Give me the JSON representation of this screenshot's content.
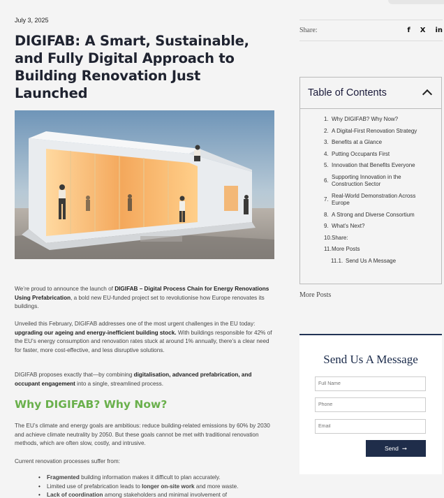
{
  "article": {
    "date": "July 3, 2025",
    "title": "DIGIFAB: A Smart, Sustainable, and Fully Digital Approach to Building Renovation Just Launched",
    "p1_a": "We’re proud to announce the launch of ",
    "p1_b": "DIGIFAB – Digital Process Chain for Energy Renovations Using Prefabrication",
    "p1_c": ", a bold new EU-funded project set to revolutionise how Europe renovates its buildings.",
    "p2_a": "Unveiled this February, DIGIFAB addresses one of the most urgent challenges in the EU today: ",
    "p2_b": "upgrading our ageing and energy-inefficient building stock.",
    "p2_c": " With buildings responsible for 42% of the EU’s energy consumption and renovation rates stuck at around 1% annually, there’s a clear need for faster, more cost-effective, and less disruptive solutions.",
    "p3_a": "DIGIFAB proposes exactly that—by combining ",
    "p3_b": "digitalisation, advanced prefabrication, and occupant engagement",
    "p3_c": " into a single, streamlined process.",
    "h2": "Why DIGIFAB? Why Now?",
    "p4": "The EU’s climate and energy goals are ambitious: reduce building-related emissions by 60% by 2030 and achieve climate neutrality by 2050. But these goals cannot be met with traditional renovation methods, which are often slow, costly, and intrusive.",
    "p5": "Current renovation processes suffer from:",
    "bullets": [
      {
        "bold": "Fragmented",
        "text": " building information makes it difficult to plan accurately."
      },
      {
        "pre": "Limited use of prefabrication leads to ",
        "bold": "longer on-site work",
        "text": " and more waste."
      },
      {
        "bold": "Lack of coordination",
        "text": " among stakeholders and minimal involvement of"
      }
    ]
  },
  "sidebar": {
    "share_label": "Share:",
    "share_icons": [
      "f",
      "X",
      "in"
    ],
    "toc_title": "Table of Contents",
    "toc": [
      {
        "num": "1.",
        "text": "Why DIGIFAB? Why Now?"
      },
      {
        "num": "2.",
        "text": "A Digital-First Renovation Strategy"
      },
      {
        "num": "3.",
        "text": "Benefits at a Glance"
      },
      {
        "num": "4.",
        "text": "Putting Occupants First"
      },
      {
        "num": "5.",
        "text": "Innovation that Benefits Everyone"
      },
      {
        "num": "6.",
        "text": "Supporting Innovation in the Construction Sector"
      },
      {
        "num": "7.",
        "text": "Real-World Demonstration Across Europe"
      },
      {
        "num": "8.",
        "text": "A Strong and Diverse Consortium"
      },
      {
        "num": "9.",
        "text": "What’s Next?"
      },
      {
        "num": "10.",
        "text": "Share:"
      },
      {
        "num": "11.",
        "text": "More Posts"
      },
      {
        "num": "11.1.",
        "text": "Send Us A Message"
      }
    ],
    "more_posts": "More Posts"
  },
  "form": {
    "title": "Send Us A Message",
    "name_placeholder": "Full Name",
    "phone_placeholder": "Phone",
    "email_placeholder": "Email",
    "send_label": "Send",
    "send_arrow": "➞"
  }
}
